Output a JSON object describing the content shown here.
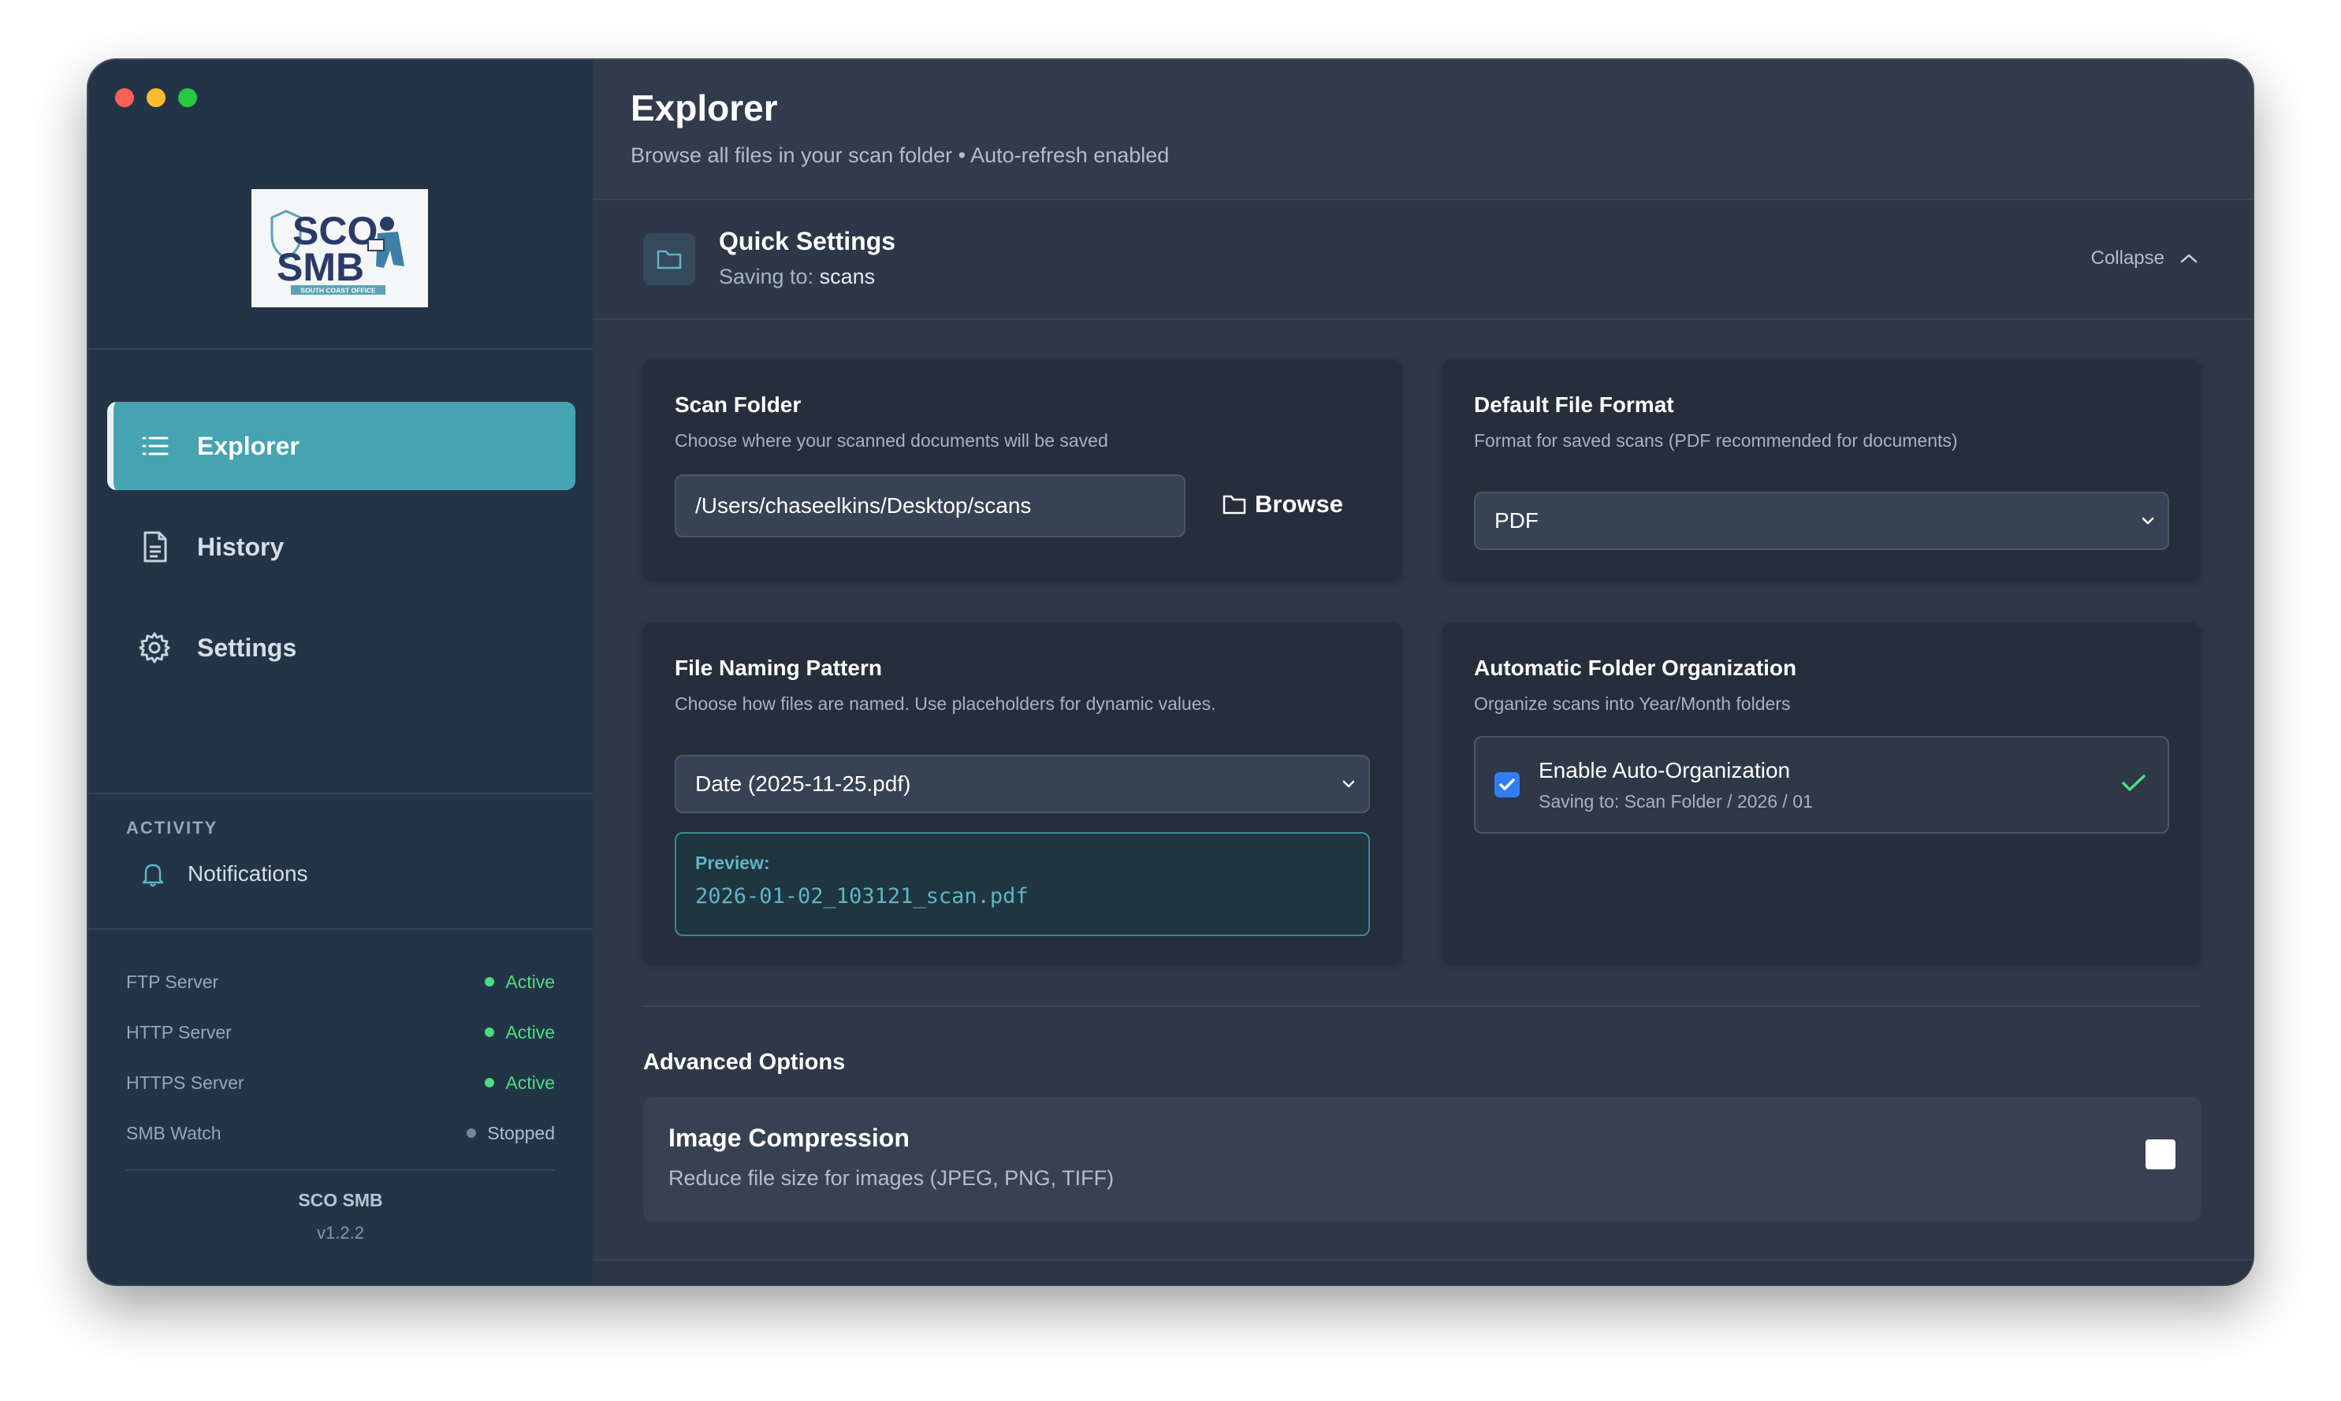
{
  "sidebar": {
    "logo": {
      "line1": "SCO",
      "line2": "SMB",
      "tagline": "SOUTH COAST OFFICE"
    },
    "nav": [
      {
        "label": "Explorer",
        "icon": "list-icon",
        "active": true
      },
      {
        "label": "History",
        "icon": "document-icon",
        "active": false
      },
      {
        "label": "Settings",
        "icon": "gear-icon",
        "active": false
      }
    ],
    "activity_label": "ACTIVITY",
    "notifications_label": "Notifications",
    "services": [
      {
        "name": "FTP Server",
        "status": "Active",
        "color": "#4ade80"
      },
      {
        "name": "HTTP Server",
        "status": "Active",
        "color": "#4ade80"
      },
      {
        "name": "HTTPS Server",
        "status": "Active",
        "color": "#4ade80"
      },
      {
        "name": "SMB Watch",
        "status": "Stopped",
        "color": "#7a8594"
      }
    ],
    "app_name": "SCO SMB",
    "version": "v1.2.2"
  },
  "header": {
    "title": "Explorer",
    "subtitle": "Browse all files in your scan folder • Auto-refresh enabled"
  },
  "quick_settings": {
    "title": "Quick Settings",
    "saving_prefix": "Saving to:",
    "saving_folder": "scans",
    "collapse_label": "Collapse"
  },
  "scan_folder": {
    "title": "Scan Folder",
    "description": "Choose where your scanned documents will be saved",
    "path": "/Users/chaseelkins/Desktop/scans",
    "browse_label": "Browse"
  },
  "file_format": {
    "title": "Default File Format",
    "description": "Format for saved scans (PDF recommended for documents)",
    "selected": "PDF"
  },
  "naming": {
    "title": "File Naming Pattern",
    "description": "Choose how files are named. Use placeholders for dynamic values.",
    "selected": "Date (2025-11-25.pdf)",
    "preview_label": "Preview:",
    "preview_value": "2026-01-02_103121_scan.pdf"
  },
  "auto_org": {
    "title": "Automatic Folder Organization",
    "description": "Organize scans into Year/Month folders",
    "toggle_label": "Enable Auto-Organization",
    "toggle_sub": "Saving to: Scan Folder / 2026 / 01",
    "enabled": true
  },
  "advanced": {
    "title": "Advanced Options",
    "items": [
      {
        "name": "Image Compression",
        "description": "Reduce file size for images (JPEG, PNG, TIFF)",
        "enabled": false
      }
    ]
  },
  "colors": {
    "accent": "#46a3b2",
    "sidebar_bg": "#243447",
    "main_bg": "#2f3848",
    "active_green": "#4ade80",
    "checkbox_blue": "#2f7ef0"
  }
}
